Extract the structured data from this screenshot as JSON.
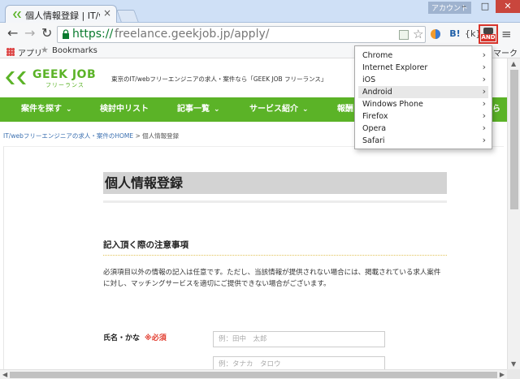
{
  "browser": {
    "tab_title": "個人情報登録 | IT/webフ",
    "tab_close": "×",
    "account_label": "アカウント",
    "window_minimize": "–",
    "window_maximize": "□",
    "window_close": "✕",
    "url_scheme": "https://",
    "url_rest": "freelance.geekjob.jp/apply/",
    "extensions": {
      "ext2": "B!",
      "ext3": "{k}",
      "ext4_badge": "AND"
    }
  },
  "bookmarks": {
    "apps": "アプリ",
    "bookmarks": "Bookmarks",
    "other": "マーク"
  },
  "site": {
    "logo_text": "GEEK JOB",
    "logo_sub": "フリーランス",
    "tagline": "東京のIT/webフリーエンジニアの求人・案件なら「GEEK JOB フリーランス」",
    "nav": [
      {
        "label": "案件を探す",
        "caret": "⌄"
      },
      {
        "label": "検討中リスト",
        "caret": ""
      },
      {
        "label": "記事一覧",
        "caret": "⌄"
      },
      {
        "label": "サービス紹介",
        "caret": "⌄"
      },
      {
        "label": "報酬",
        "caret": ""
      },
      {
        "label": "ら",
        "caret": ""
      }
    ],
    "breadcrumb_link": "IT/webフリーエンジニアの求人・案件のHOME",
    "breadcrumb_sep": ">",
    "breadcrumb_current": "個人情報登録",
    "page_title": "個人情報登録",
    "section_heading": "記入頂く際の注意事項",
    "notice": "必須項目以外の情報の記入は任意です。ただし、当該情報が提供されない場合には、掲載されている求人案件に対し、マッチングサービスを適切にご提供できない場合がございます。",
    "field_name_label": "氏名・かな",
    "required_mark": "※必須",
    "name_placeholder": "例：田中　太郎",
    "kana_placeholder": "例：タナカ　タロウ"
  },
  "dropdown": {
    "items": [
      "Chrome",
      "Internet Explorer",
      "iOS",
      "Android",
      "Windows Phone",
      "Firefox",
      "Opera",
      "Safari"
    ],
    "active": "Android",
    "chevron": "›"
  }
}
